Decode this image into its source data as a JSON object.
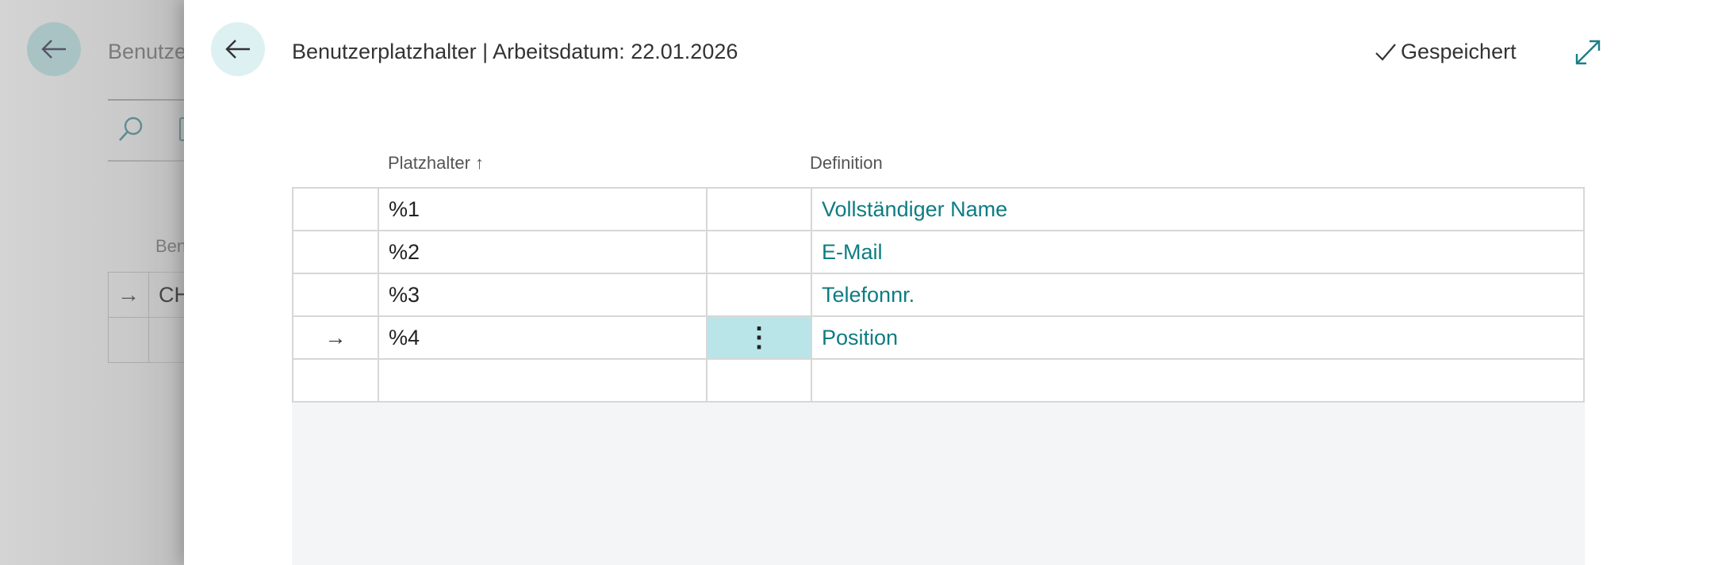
{
  "background_page": {
    "title": "Benutze",
    "column_label": "Ben",
    "rows": [
      {
        "marker": "→",
        "value": "CH"
      },
      {
        "marker": "",
        "value": ""
      }
    ]
  },
  "dialog": {
    "title": "Benutzerplatzhalter | Arbeitsdatum: 22.01.2026",
    "saved_status": "Gespeichert",
    "columns": {
      "placeholder": "Platzhalter",
      "definition": "Definition"
    },
    "sort_indicator": "↑",
    "rows": [
      {
        "marker": "",
        "placeholder": "%1",
        "menu": "",
        "definition": "Vollständiger Name"
      },
      {
        "marker": "",
        "placeholder": "%2",
        "menu": "",
        "definition": "E-Mail"
      },
      {
        "marker": "",
        "placeholder": "%3",
        "menu": "",
        "definition": "Telefonnr."
      },
      {
        "marker": "→",
        "placeholder": "%4",
        "menu": "⋮",
        "definition": "Position"
      },
      {
        "marker": "",
        "placeholder": "",
        "menu": "",
        "definition": ""
      }
    ]
  },
  "colors": {
    "accent": "#0e7c82",
    "back_button_bg": "#ddf0f2",
    "selected_cell": "#b9e5e9"
  },
  "icons": [
    "back-arrow-icon",
    "search-icon",
    "document-icon",
    "checkmark-icon",
    "expand-icon",
    "row-arrow-icon",
    "more-options-icon",
    "sort-ascending-icon"
  ]
}
